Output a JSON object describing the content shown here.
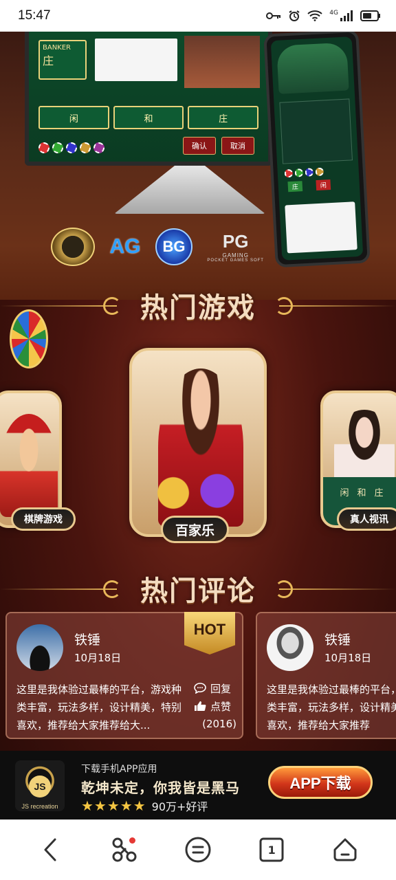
{
  "status_bar": {
    "time": "15:47",
    "network_label": "4G"
  },
  "banner": {
    "monitor": {
      "banker_label": "BANKER",
      "banker_cn": "庄",
      "bet_cells": [
        "闲",
        "和",
        "庄"
      ],
      "confirm_label": "确认",
      "cancel_label": "取消"
    },
    "phone": {
      "tabs": [
        "庄",
        "闲"
      ]
    },
    "providers": [
      {
        "name": "crown-logo",
        "text": ""
      },
      {
        "name": "ag-logo",
        "text": "AG"
      },
      {
        "name": "bg-logo",
        "text": "BG"
      },
      {
        "name": "pg-logo",
        "text": "PG",
        "subtext": "GAMING",
        "subsub": "POCKET GAMES SOFT"
      }
    ]
  },
  "hot_games": {
    "title": "热门游戏",
    "cards": [
      {
        "label": "棋牌游戏"
      },
      {
        "label": "百家乐"
      },
      {
        "label": "真人视讯",
        "table_text": [
          "闲",
          "和",
          "庄"
        ]
      }
    ]
  },
  "hot_comments": {
    "title": "热门评论",
    "items": [
      {
        "user": "铁锤",
        "date": "10月18日",
        "body": "这里是我体验过最棒的平台，游戏种类丰富，玩法多样，设计精美，特别喜欢，推荐给大家推荐给大...",
        "hot": "HOT",
        "reply_label": "回复",
        "like_label": "点赞",
        "count": "(2016)"
      },
      {
        "user": "铁锤",
        "date": "10月18日",
        "body": "这里是我体验过最棒的平台，游戏种类丰富，玩法多样，设计精美，特别喜欢，推荐给大家推荐"
      }
    ]
  },
  "download_bar": {
    "logo_text": "JS",
    "brand": "JS recreation",
    "subtitle": "下载手机APP应用",
    "slogan": "乾坤未定，你我皆是黑马",
    "stars": "★★★★★",
    "rating_text": "90万+好评",
    "button_label": "APP下载"
  },
  "nav_bar": {
    "tab_count": "1"
  }
}
